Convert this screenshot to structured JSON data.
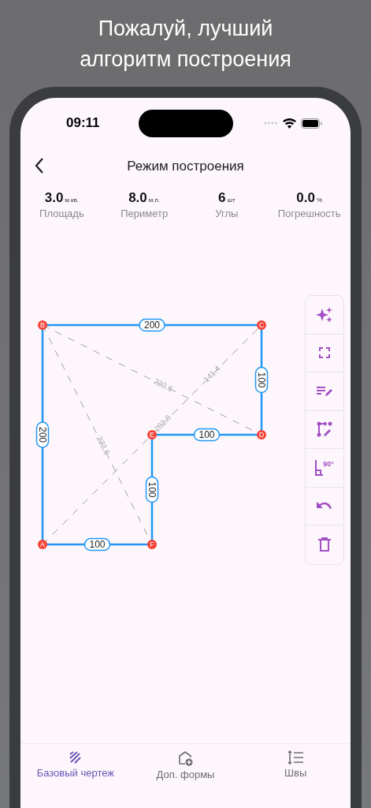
{
  "headline": [
    "Пожалуй, лучший",
    "алгоритм построения"
  ],
  "status_bar": {
    "time": "09:11"
  },
  "nav": {
    "title": "Режим построения"
  },
  "stats": [
    {
      "value": "3.0",
      "unit": "м.кв.",
      "label": "Площадь"
    },
    {
      "value": "8.0",
      "unit": "м.п.",
      "label": "Периметр"
    },
    {
      "value": "6",
      "unit": "шт",
      "label": "Углы"
    },
    {
      "value": "0.0",
      "unit": "%",
      "label": "Погрешность"
    }
  ],
  "drawing": {
    "vertices": [
      "A",
      "B",
      "C",
      "D",
      "E",
      "F"
    ],
    "edges": [
      {
        "length": "200"
      },
      {
        "length": "200"
      },
      {
        "length": "100"
      },
      {
        "length": "100"
      },
      {
        "length": "100"
      },
      {
        "length": "100"
      }
    ],
    "diagonals": [
      {
        "label": "223.6"
      },
      {
        "label": "223.6"
      },
      {
        "label": "282.8"
      },
      {
        "label": "141.4"
      }
    ]
  },
  "tools": [
    {
      "kind": "magic"
    },
    {
      "kind": "fit"
    },
    {
      "kind": "notes"
    },
    {
      "kind": "path"
    },
    {
      "kind": "angle",
      "text": "90°"
    },
    {
      "kind": "undo"
    },
    {
      "kind": "delete"
    }
  ],
  "tabs": [
    {
      "kind": "draft",
      "label": "Базовый чертеж",
      "selected": true
    },
    {
      "kind": "shapes",
      "label": "Доп. формы",
      "selected": false
    },
    {
      "kind": "seams",
      "label": "Швы",
      "selected": false
    }
  ]
}
